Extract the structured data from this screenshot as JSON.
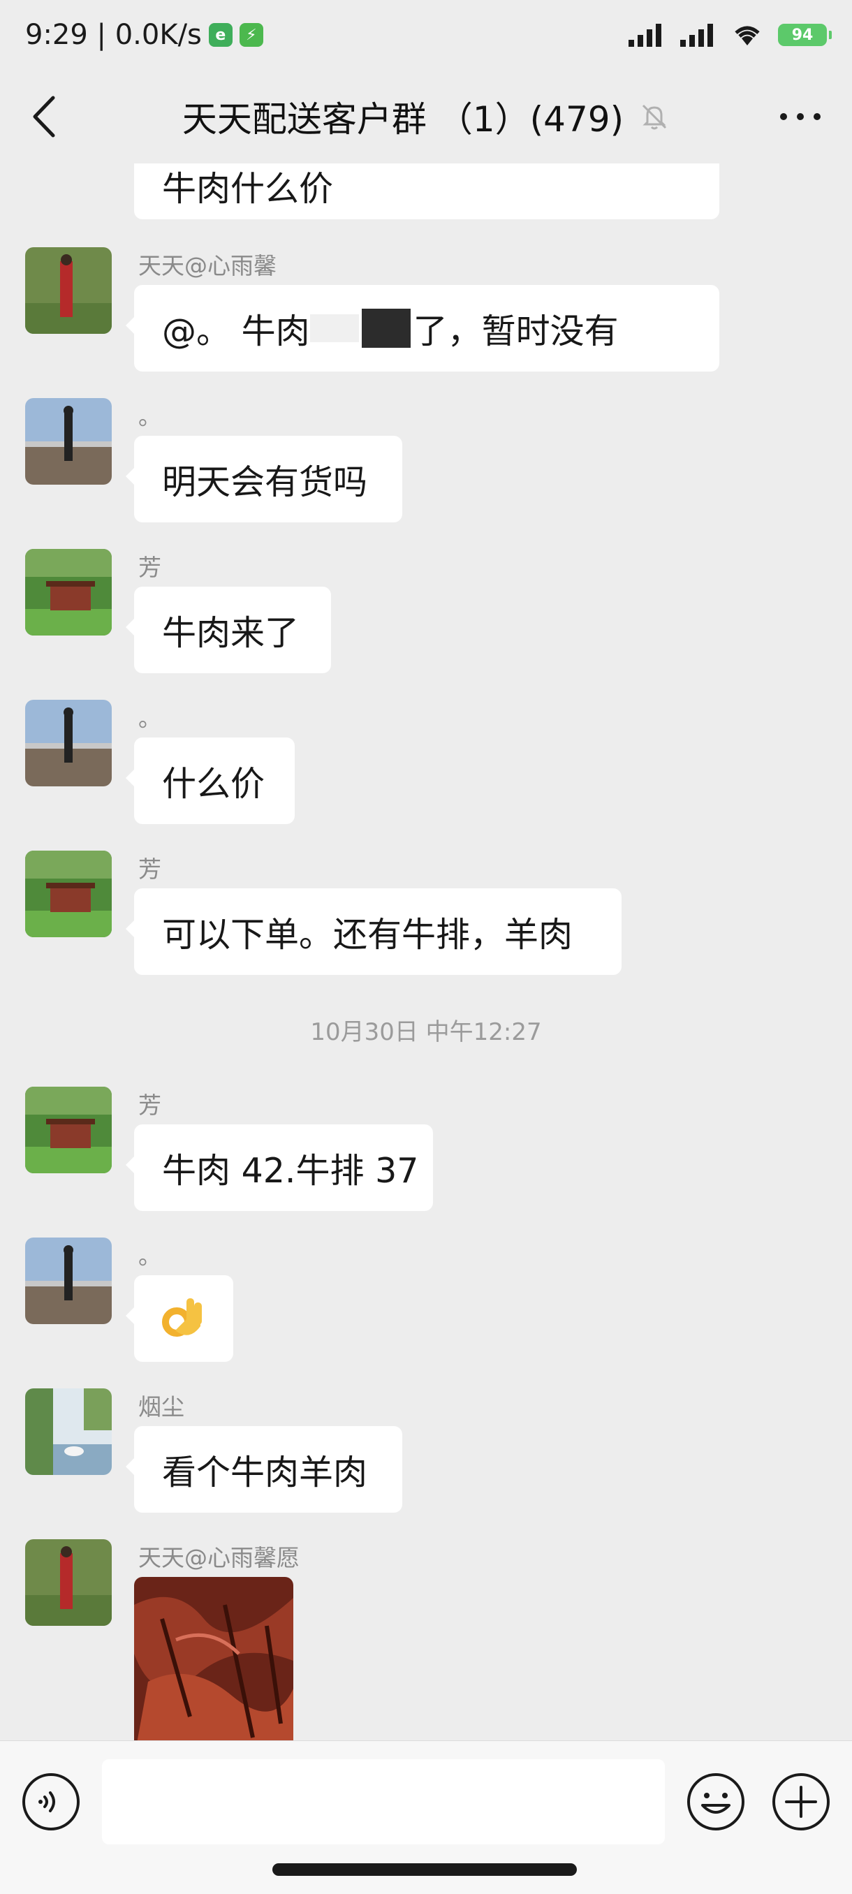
{
  "status_bar": {
    "time": "9:29 | 0.0K/s",
    "battery": "94"
  },
  "header": {
    "title": "天天配送客户群 （1）(479)",
    "back_icon": "chevron-left-icon",
    "mute_icon": "bell-off-icon",
    "more_icon": "more-dots-icon"
  },
  "messages": [
    {
      "sender": "",
      "text": "牛肉什么价"
    },
    {
      "sender": "天天@心雨馨",
      "text_before": "@。 牛肉",
      "text_after": "了，暂时没有"
    },
    {
      "sender": "。",
      "text": "明天会有货吗"
    },
    {
      "sender": "芳",
      "text": "牛肉来了"
    },
    {
      "sender": "。",
      "text": "什么价"
    },
    {
      "sender": "芳",
      "text": "可以下单。还有牛排，羊肉"
    },
    {
      "sender": "芳",
      "text": "牛肉 42.牛排 37"
    },
    {
      "sender": "。",
      "text": "👌"
    },
    {
      "sender": "烟尘",
      "text": "看个牛肉羊肉"
    },
    {
      "sender": "天天@心雨馨愿",
      "text": ""
    }
  ],
  "timestamp": "10月30日 中午12:27",
  "input_bar": {
    "voice_icon": "voice-icon",
    "emoji_icon": "emoji-icon",
    "plus_icon": "plus-icon",
    "placeholder": ""
  },
  "colors": {
    "background": "#ededed",
    "bubble": "#ffffff",
    "battery": "#5cc96a"
  }
}
